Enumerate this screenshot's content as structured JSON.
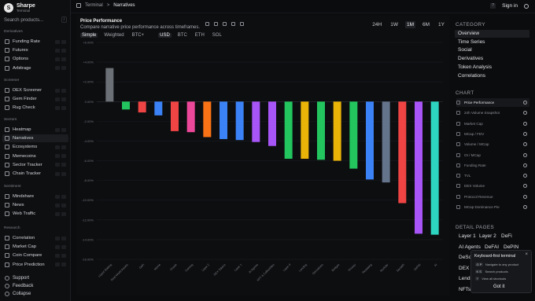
{
  "brand": {
    "name": "Sharpe",
    "sub": "Terminal",
    "logo_glyph": "S"
  },
  "search": {
    "placeholder": "Search products...",
    "shortcut": "/"
  },
  "sidebar": {
    "sections": [
      {
        "title": "Derivatives",
        "items": [
          "Funding Rate",
          "Futures",
          "Options",
          "Arbitrage"
        ]
      },
      {
        "title": "Screener",
        "items": [
          "DEX Screener",
          "Gem Finder",
          "Rug Check"
        ]
      },
      {
        "title": "Sectors",
        "items": [
          "Heatmap",
          "Narratives",
          "Ecosystems",
          "Memecoins",
          "Sector Tracker",
          "Chain Tracker"
        ]
      },
      {
        "title": "Sentiment",
        "items": [
          "Mindshare",
          "News",
          "Web Traffic"
        ]
      },
      {
        "title": "Research",
        "items": [
          "Correlation",
          "Market Cap",
          "Coin Compare",
          "Price Prediction"
        ]
      }
    ],
    "active_item": "Narratives",
    "footer": [
      "Support",
      "Feedback",
      "Collapse"
    ]
  },
  "topbar": {
    "breadcrumb_root": "Terminal",
    "breadcrumb_sep": ">",
    "breadcrumb_current": "Narratives",
    "help": "?",
    "signin": "Sign in"
  },
  "panel": {
    "title": "Price Performance",
    "subtitle": "Compare narrative price performance across timeframes.",
    "modes": [
      "Simple",
      "Weighted",
      "BTC+"
    ],
    "mode_selected": "Simple",
    "currencies": [
      "USD",
      "BTC",
      "ETH",
      "SOL"
    ],
    "currency_selected": "USD",
    "timeframes": [
      "24H",
      "1W",
      "1M",
      "6M",
      "1Y"
    ],
    "timeframe_selected": "1M"
  },
  "chart_data": {
    "type": "bar",
    "ylim": [
      -8,
      6
    ],
    "yticks": [
      6,
      4,
      2,
      0,
      -2,
      -4,
      -6,
      -8,
      -10,
      -12,
      -14,
      -16
    ],
    "ytick_labels": [
      "+6.00%",
      "+4.00%",
      "+2.00%",
      "0.00%",
      "-2.00%",
      "-4.00%",
      "-6.00%",
      "-8.00%",
      "-10.00%",
      "-12.00%",
      "-14.00%",
      "-16.00%"
    ],
    "categories": [
      "Liquid Staking",
      "Real World Assets",
      "DeFi",
      "Meme",
      "Oracle",
      "Gaming",
      "Layer 2",
      "DEX Tokens",
      "Layer 1",
      "AI Agents",
      "NFT & Collectibles",
      "Layer 0",
      "Lending",
      "Derivatives",
      "Bridges",
      "Privacy",
      "Restaking",
      "Modular",
      "SocialFi",
      "DePIN",
      "AI"
    ],
    "values": [
      3.4,
      -0.8,
      -1.1,
      -1.4,
      -3.0,
      -3.1,
      -3.6,
      -3.8,
      -3.9,
      -4.1,
      -4.5,
      -5.8,
      -5.8,
      -5.9,
      -6.0,
      -6.8,
      -7.9,
      -8.2,
      -10.3,
      -13.4,
      -13.5
    ],
    "colors": [
      "#6b7076",
      "#22c55e",
      "#ef4444",
      "#3b82f6",
      "#ef4444",
      "#ec4899",
      "#f97316",
      "#3b82f6",
      "#3b82f6",
      "#a855f7",
      "#a855f7",
      "#22c55e",
      "#eab308",
      "#22c55e",
      "#eab308",
      "#22c55e",
      "#3b82f6",
      "#64748b",
      "#ef4444",
      "#a855f7",
      "#2dd4bf"
    ]
  },
  "right": {
    "category_title": "CATEGORY",
    "categories": [
      "Overview",
      "Time Series",
      "Social",
      "Derivatives",
      "Token Analysis",
      "Correlations"
    ],
    "category_selected": "Overview",
    "chart_title": "CHART",
    "charts": [
      "Price Performance",
      "24h Volume Snapshot",
      "Market Cap",
      "MCap / FDV",
      "Volume / MCap",
      "OI / MCap",
      "Funding Rate",
      "TVL",
      "DEX Volume",
      "Protocol Revenue",
      "MCap Dominance Pie"
    ],
    "chart_selected": "Price Performance",
    "detail_title": "DETAIL PAGES",
    "detail_pages": [
      "Layer 1",
      "Layer 2",
      "DeFi",
      "AI Agents",
      "DeFAI",
      "DePIN",
      "DeSci",
      "DEX",
      "Lending",
      "NFTs"
    ]
  },
  "popup": {
    "title": "Keyboard-first terminal",
    "rows": [
      {
        "keys": "G  P",
        "text": "Navigate to any product"
      },
      {
        "keys": "K  S",
        "text": "Search products"
      },
      {
        "keys": "?",
        "text": "View all shortcuts"
      }
    ],
    "button": "Got it"
  }
}
